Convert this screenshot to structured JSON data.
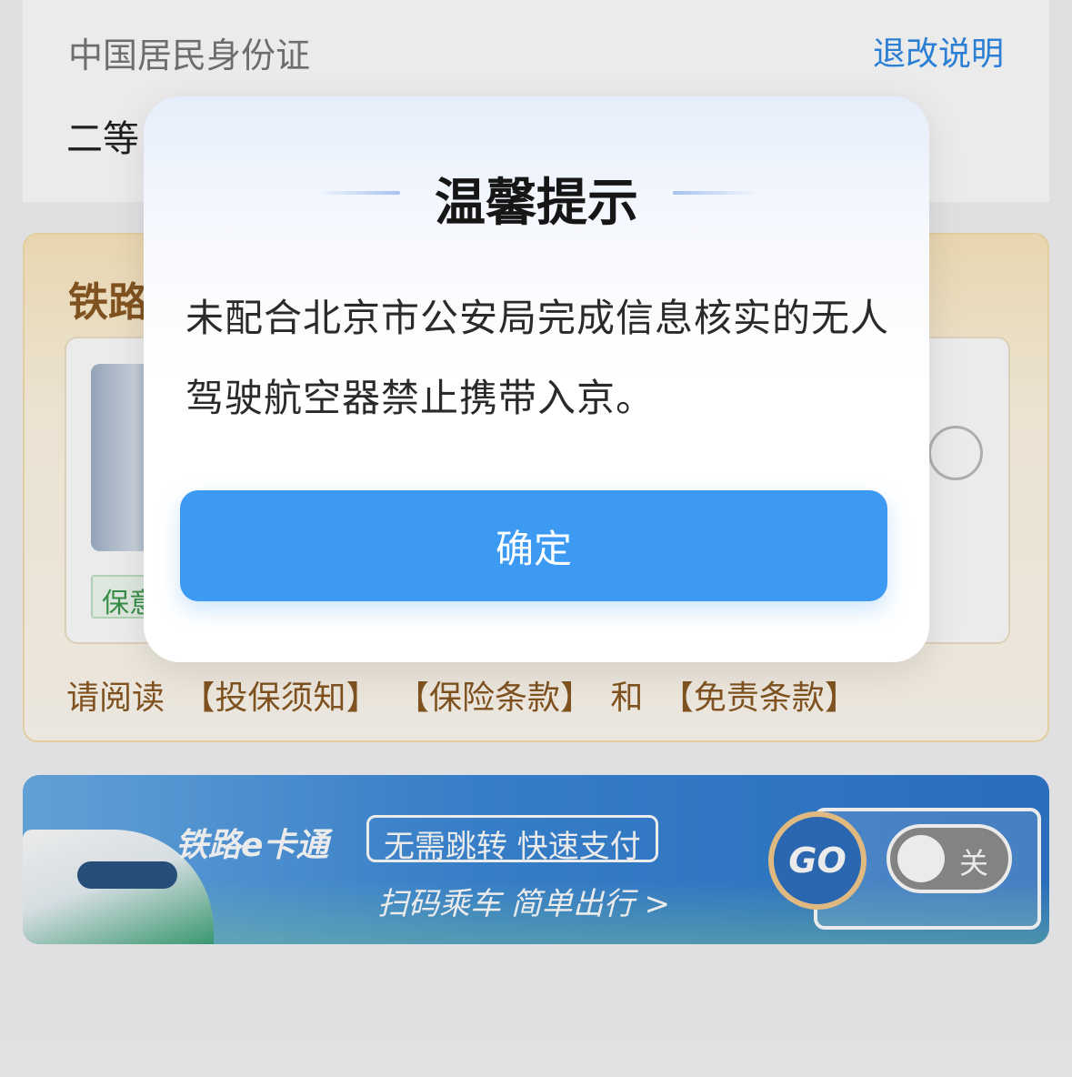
{
  "passenger": {
    "id_type": "中国居民身份证",
    "refund_link": "退改说明",
    "seat_class": "二等"
  },
  "insurance": {
    "title": "铁路",
    "plan_tag": "保意",
    "terms_prefix": "请阅读",
    "terms_notice": "【投保须知】",
    "terms_clauses": "【保险条款】",
    "terms_and": "和",
    "terms_exemption": "【免责条款】"
  },
  "ecard_banner": {
    "brand": "铁路e卡通",
    "slogan": "无需跳转  快速支付",
    "subtitle": "扫码乘车  简单出行 >",
    "go_label": "GO",
    "toggle_label": "关",
    "toggle_state": "off"
  },
  "modal": {
    "title": "温馨提示",
    "message": "未配合北京市公安局完成信息核实的无人驾驶航空器禁止携带入京。",
    "confirm_label": "确定"
  },
  "colors": {
    "accent_blue": "#3d9af2",
    "link_blue": "#2f8ae6",
    "insurance_brown": "#8a5a23"
  }
}
